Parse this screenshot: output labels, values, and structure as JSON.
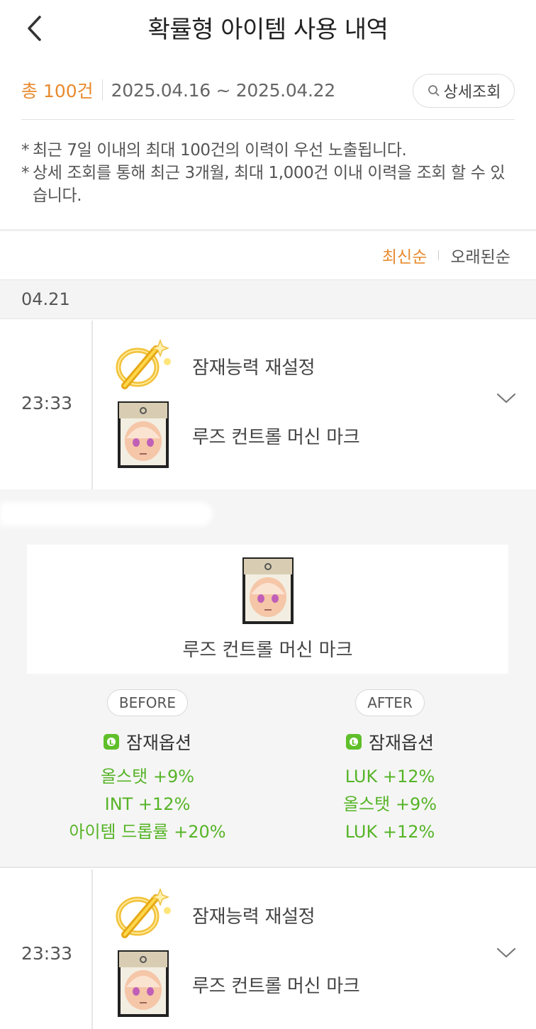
{
  "header": {
    "title": "확률형 아이템 사용 내역"
  },
  "summary": {
    "total": "총 100건",
    "date_range": "2025.04.16 ~ 2025.04.22",
    "detail_button": "상세조회"
  },
  "notes": [
    {
      "mark": "*",
      "text": "최근 7일 이내의 최대 100건의 이력이 우선 노출됩니다."
    },
    {
      "mark": "*",
      "text": "상세 조회를 통해 최근 3개월, 최대 1,000건 이내 이력을 조회 할 수 있습니다."
    }
  ],
  "sort": {
    "options": [
      "최신순",
      "오래된순"
    ],
    "active": "최신순"
  },
  "date_group": "04.21",
  "entries": [
    {
      "time": "23:33",
      "action": "잠재능력 재설정",
      "item": "루즈 컨트롤 머신 마크",
      "expanded": true
    },
    {
      "time": "23:33",
      "action": "잠재능력 재설정",
      "item": "루즈 컨트롤 머신 마크",
      "expanded": false
    }
  ],
  "detail": {
    "item_name": "루즈 컨트롤 머신 마크",
    "before": {
      "label": "BEFORE",
      "grade_badge": "L",
      "option_title": "잠재옵션",
      "options": [
        "올스탯 +9%",
        "INT +12%",
        "아이템 드롭률 +20%"
      ]
    },
    "after": {
      "label": "AFTER",
      "grade_badge": "L",
      "option_title": "잠재옵션",
      "options": [
        "LUK +12%",
        "올스탯 +9%",
        "LUK +12%"
      ]
    }
  },
  "colors": {
    "accent": "#e88a2e",
    "legendary": "#56b427",
    "legendary_badge": "#5fbf2a",
    "section_bg": "#f5f5f5"
  },
  "icons": {
    "back": "chevron-left-icon",
    "search": "search-icon",
    "cube": "potential-reset-cube-icon",
    "item": "machine-mark-item-icon",
    "expand": "chevron-down-icon"
  }
}
